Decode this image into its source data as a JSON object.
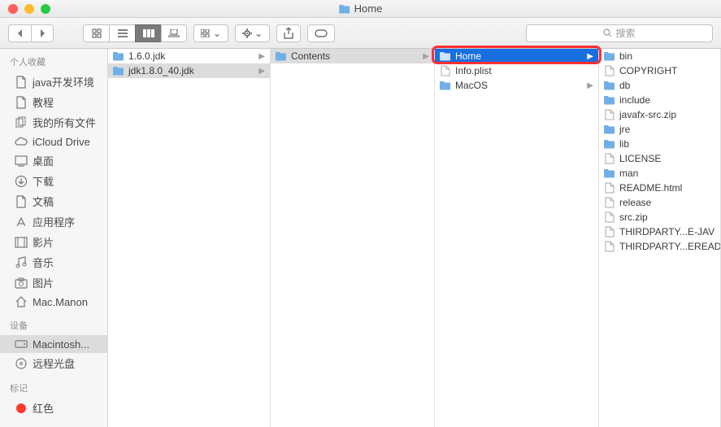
{
  "window": {
    "title": "Home"
  },
  "search": {
    "placeholder": "搜索"
  },
  "sidebar": {
    "sections": [
      {
        "header": "个人收藏",
        "items": [
          {
            "label": "java开发环境",
            "icon": "doc"
          },
          {
            "label": "教程",
            "icon": "doc"
          },
          {
            "label": "我的所有文件",
            "icon": "all"
          },
          {
            "label": "iCloud Drive",
            "icon": "cloud"
          },
          {
            "label": "桌面",
            "icon": "desktop"
          },
          {
            "label": "下载",
            "icon": "download"
          },
          {
            "label": "文稿",
            "icon": "doc"
          },
          {
            "label": "应用程序",
            "icon": "app"
          },
          {
            "label": "影片",
            "icon": "movie"
          },
          {
            "label": "音乐",
            "icon": "music"
          },
          {
            "label": "图片",
            "icon": "photo"
          },
          {
            "label": "Mac.Manon",
            "icon": "home"
          }
        ]
      },
      {
        "header": "设备",
        "items": [
          {
            "label": "Macintosh...",
            "icon": "hdd",
            "selected": true
          },
          {
            "label": "远程光盘",
            "icon": "disc"
          }
        ]
      },
      {
        "header": "标记",
        "items": [
          {
            "label": "红色",
            "icon": "tag-red"
          }
        ]
      }
    ]
  },
  "columns": [
    {
      "items": [
        {
          "label": "1.6.0.jdk",
          "type": "folder",
          "arrow": true
        },
        {
          "label": "jdk1.8.0_40.jdk",
          "type": "folder",
          "selected": "grey",
          "arrow": true
        }
      ]
    },
    {
      "items": [
        {
          "label": "Contents",
          "type": "folder",
          "selected": "grey",
          "arrow": true
        }
      ]
    },
    {
      "items": [
        {
          "label": "Home",
          "type": "folder",
          "selected": "blue",
          "arrow": true
        },
        {
          "label": "Info.plist",
          "type": "file"
        },
        {
          "label": "MacOS",
          "type": "folder",
          "arrow": true
        }
      ]
    },
    {
      "items": [
        {
          "label": "bin",
          "type": "folder"
        },
        {
          "label": "COPYRIGHT",
          "type": "file"
        },
        {
          "label": "db",
          "type": "folder"
        },
        {
          "label": "include",
          "type": "folder"
        },
        {
          "label": "javafx-src.zip",
          "type": "file"
        },
        {
          "label": "jre",
          "type": "folder"
        },
        {
          "label": "lib",
          "type": "folder"
        },
        {
          "label": "LICENSE",
          "type": "file"
        },
        {
          "label": "man",
          "type": "folder"
        },
        {
          "label": "README.html",
          "type": "file"
        },
        {
          "label": "release",
          "type": "file"
        },
        {
          "label": "src.zip",
          "type": "file"
        },
        {
          "label": "THIRDPARTY...E-JAV",
          "type": "file"
        },
        {
          "label": "THIRDPARTY...EREAD",
          "type": "file"
        }
      ]
    }
  ]
}
